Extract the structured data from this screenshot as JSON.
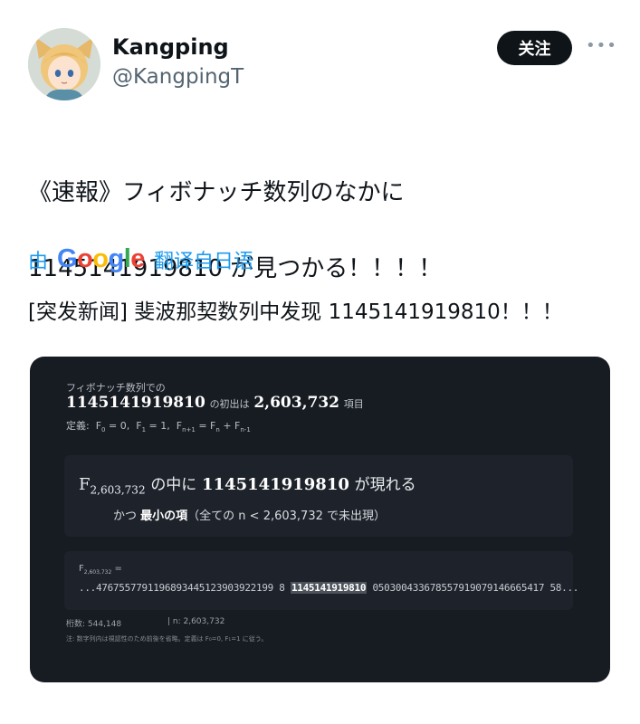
{
  "author": {
    "name": "Kangping",
    "handle": "@KangpingT",
    "avatar_icon": "anime-avatar"
  },
  "follow_label": "关注",
  "more_icon": "more-dots-icon",
  "tweet": {
    "line1": "《速報》フィボナッチ数列のなかに",
    "line2": "1145141919810 が見つかる！！！！"
  },
  "translation": {
    "prefix": "由",
    "google": "Google",
    "suffix": "翻译自日语",
    "text": "[突发新闻] 斐波那契数列中发现 1145141919810！！！"
  },
  "card": {
    "caption": "フィボナッチ数列での",
    "num": "1145141919810",
    "mid": "の初出は",
    "index": "2,603,732",
    "unit": "項目",
    "def": {
      "label": "定義:",
      "f0": "F",
      "f0s": "0",
      "f0v": "= 0,",
      "f1": "F",
      "f1s": "1",
      "f1v": "= 1,",
      "fn": "F",
      "fns": "n+1",
      "eq": "= F",
      "fn2s": "n",
      "plus": "+ F",
      "fn3s": "n-1"
    },
    "box1": {
      "f": "F",
      "sub": "2,603,732",
      "text1": "の中に",
      "num": "1145141919810",
      "text2": "が現れる",
      "line2a": "かつ",
      "line2b": "最小の項",
      "line2c": "（全ての n < 2,603,732 で未出現）"
    },
    "box2": {
      "f": "F",
      "sub": "2,603,732",
      "eq": "=",
      "pre": "...4767557791196893445123903922199 8",
      "hl": "1145141919810",
      "post": "050300433678557919079146665417 58..."
    },
    "stats": {
      "digits": "桁数: 544,148",
      "n": "| n: 2,603,732"
    },
    "note": "注: 数字列内は視認性のため前後を省略。定義は F₀=0, F₁=1 に従う。"
  },
  "colors": {
    "accent": "#1d9bf0",
    "card_bg": "#171b22"
  }
}
